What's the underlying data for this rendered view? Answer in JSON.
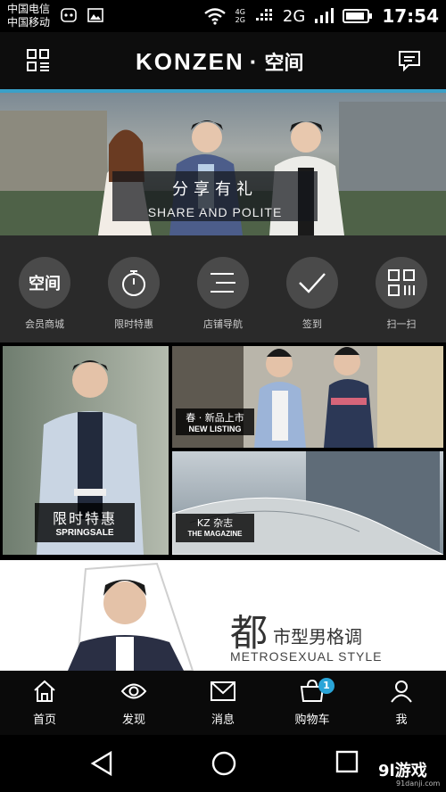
{
  "status_bar": {
    "carrier_1": "中国电信",
    "carrier_2": "中国移动",
    "network_small_1": "4G",
    "network_small_2": "2G",
    "network": "2G",
    "time": "17:54"
  },
  "header": {
    "brand_latin": "KONZEN",
    "brand_dot": "·",
    "brand_cn": "空间",
    "menu_icon": "grid-menu-icon",
    "message_icon": "message-icon"
  },
  "hero": {
    "title": "分享有礼",
    "subtitle": "SHARE AND POLITE"
  },
  "quick_nav": [
    {
      "label": "会员商城",
      "icon": "member-mall-icon",
      "glyph": "空间"
    },
    {
      "label": "限时特惠",
      "icon": "timer-icon"
    },
    {
      "label": "店铺导航",
      "icon": "list-icon"
    },
    {
      "label": "签到",
      "icon": "check-icon"
    },
    {
      "label": "扫一扫",
      "icon": "qr-scan-icon"
    }
  ],
  "promos": {
    "spring_sale": {
      "title": "限时特惠",
      "subtitle": "SPRINGSALE"
    },
    "new_listing": {
      "title": "春 · 新品上市",
      "subtitle": "NEW LISTING"
    },
    "magazine": {
      "title": "KZ 杂志",
      "subtitle": "THE MAGAZINE"
    }
  },
  "editorial": {
    "big_char": "都",
    "rest": "市型男格调",
    "english": "METROSEXUAL STYLE"
  },
  "tabs": [
    {
      "label": "首页",
      "icon": "home-icon"
    },
    {
      "label": "发现",
      "icon": "eye-icon"
    },
    {
      "label": "消息",
      "icon": "mail-icon"
    },
    {
      "label": "购物车",
      "icon": "cart-icon",
      "badge": "1"
    },
    {
      "label": "我",
      "icon": "person-icon"
    }
  ],
  "watermark": {
    "text": "9l游戏",
    "site": "91danji.com"
  },
  "colors": {
    "accent": "#3aa0c8",
    "badge": "#2aa5d8",
    "nav_bg": "#2a2a2a"
  }
}
